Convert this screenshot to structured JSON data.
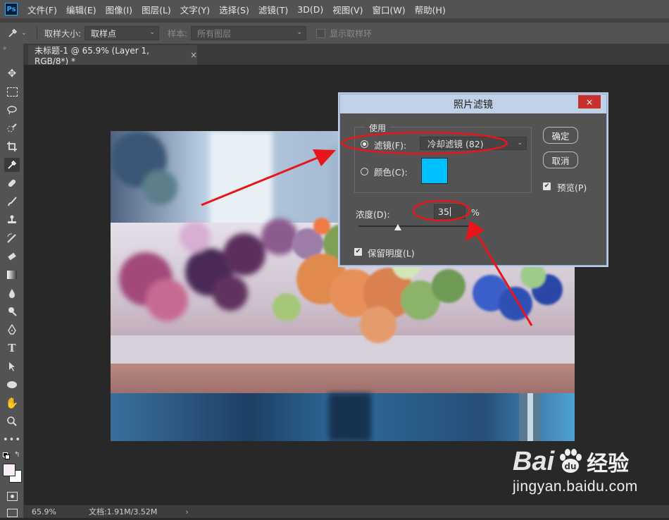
{
  "menubar": {
    "logo": "Ps",
    "items": [
      "文件(F)",
      "编辑(E)",
      "图像(I)",
      "图层(L)",
      "文字(Y)",
      "选择(S)",
      "滤镜(T)",
      "3D(D)",
      "视图(V)",
      "窗口(W)",
      "帮助(H)"
    ]
  },
  "options": {
    "sample_size_label": "取样大小:",
    "sample_size_value": "取样点",
    "sample_label": "样本:",
    "sample_value": "所有图层",
    "show_ring_label": "显示取样环"
  },
  "document": {
    "tab_title": "未标题-1 @ 65.9% (Layer 1, RGB/8*) *",
    "tab_close": "×"
  },
  "status": {
    "zoom": "65.9%",
    "doc_info": "文档:1.91M/3.52M",
    "arrow": "›"
  },
  "dialog": {
    "title": "照片滤镜",
    "close": "×",
    "use_group_label": "使用",
    "filter_label": "滤镜(F):",
    "filter_value": "冷却滤镜 (82)",
    "color_label": "颜色(C):",
    "color_swatch": "#00bfff",
    "ok_label": "确定",
    "cancel_label": "取消",
    "preview_label": "预览(P)",
    "preview_checked": true,
    "density_label": "浓度(D):",
    "density_value": "35",
    "density_unit": "%",
    "density_slider": 0.35,
    "preserve_label": "保留明度(L)",
    "preserve_checked": true
  },
  "watermark": {
    "brand_left": "Bai",
    "brand_right": "经验",
    "url": "jingyan.baidu.com"
  },
  "annotation_color": "#e8161b"
}
